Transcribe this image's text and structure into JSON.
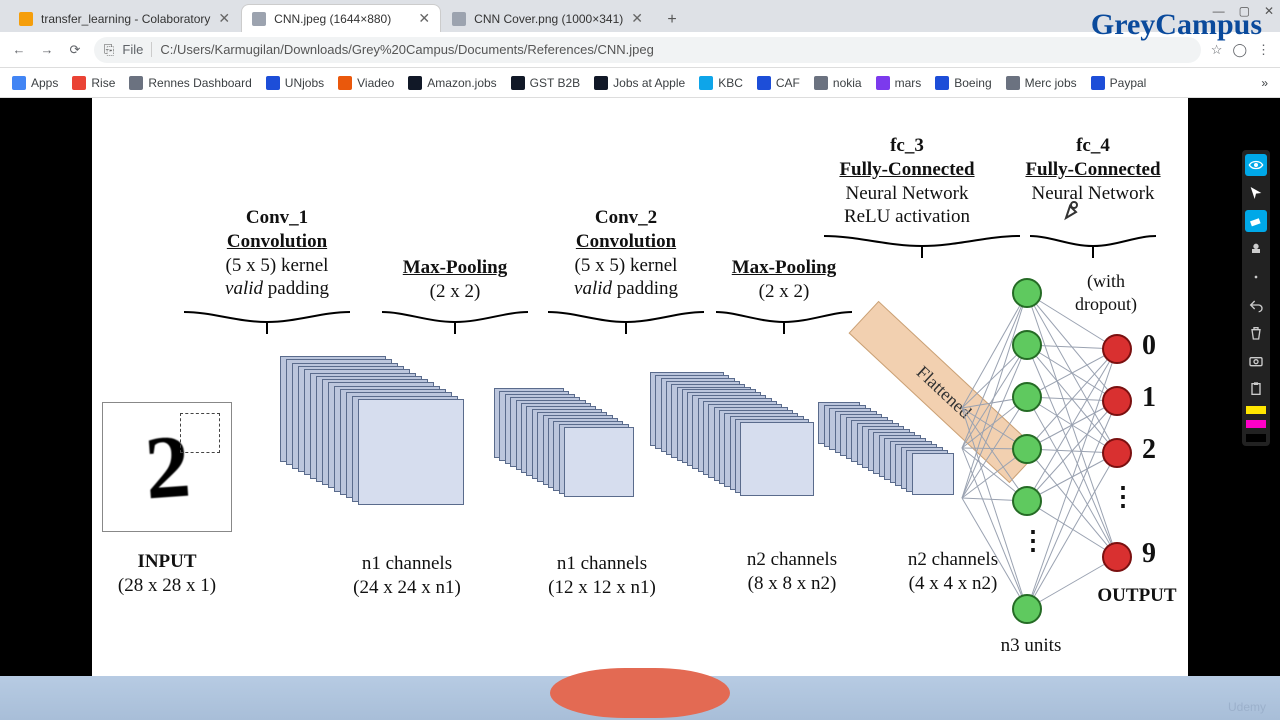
{
  "window": {
    "minimize": "—",
    "maximize": "▢",
    "close": "✕"
  },
  "tabs": [
    {
      "title": "transfer_learning - Colaboratory",
      "active": false,
      "favicon": "#f59e0b"
    },
    {
      "title": "CNN.jpeg (1644×880)",
      "active": true,
      "favicon": "#9ca3af"
    },
    {
      "title": "CNN Cover.png (1000×341)",
      "active": false,
      "favicon": "#9ca3af"
    }
  ],
  "newTab": "+",
  "nav": {
    "back": "←",
    "forward": "→",
    "reload": "⟳"
  },
  "omnibox": {
    "scheme": "File",
    "path": "C:/Users/Karmugilan/Downloads/Grey%20Campus/Documents/References/CNN.jpeg",
    "page_icon": "⎘"
  },
  "addr_right": {
    "star": "☆",
    "user": "◯",
    "menu": "⋮"
  },
  "bookmarks": [
    {
      "label": "Apps",
      "color": "#4285f4"
    },
    {
      "label": "Rise",
      "color": "#ea4335"
    },
    {
      "label": "Rennes Dashboard",
      "color": "#6b7280"
    },
    {
      "label": "UNjobs",
      "color": "#1d4ed8"
    },
    {
      "label": "Viadeo",
      "color": "#ea580c"
    },
    {
      "label": "Amazon.jobs",
      "color": "#111827"
    },
    {
      "label": "GST B2B",
      "color": "#111827"
    },
    {
      "label": "Jobs at Apple",
      "color": "#111827"
    },
    {
      "label": "KBC",
      "color": "#0ea5e9"
    },
    {
      "label": "CAF",
      "color": "#1d4ed8"
    },
    {
      "label": "nokia",
      "color": "#6b7280"
    },
    {
      "label": "mars",
      "color": "#7c3aed"
    },
    {
      "label": "Boeing",
      "color": "#1d4ed8"
    },
    {
      "label": "Merc jobs",
      "color": "#6b7280"
    },
    {
      "label": "Paypal",
      "color": "#1d4ed8"
    }
  ],
  "bookmarks_more": "»",
  "brand": "GreyCampus",
  "udemy": "Udemy",
  "diagram": {
    "input": {
      "title": "INPUT",
      "shape": "(28 x 28 x 1)",
      "glyph": "2"
    },
    "conv1": {
      "name": "Conv_1",
      "type": "Convolution",
      "kernel": "(5 x 5) kernel",
      "padding_prefix": "valid",
      "padding_suffix": " padding",
      "channels": "n1 channels",
      "outshape": "(24 x 24 x n1)"
    },
    "pool1": {
      "name": "Max-Pooling",
      "size": "(2 x 2)",
      "channels": "n1 channels",
      "outshape": "(12 x 12 x n1)"
    },
    "conv2": {
      "name": "Conv_2",
      "type": "Convolution",
      "kernel": "(5 x 5) kernel",
      "padding_prefix": "valid",
      "padding_suffix": " padding",
      "channels": "n2 channels",
      "outshape": "(8 x 8 x n2)"
    },
    "pool2": {
      "name": "Max-Pooling",
      "size": "(2 x 2)",
      "channels": "n2 channels",
      "outshape": "(4 x 4 x n2)"
    },
    "flat": "Flattened",
    "fc3": {
      "name": "fc_3",
      "type": "Fully-Connected",
      "sub1": "Neural Network",
      "sub2": "ReLU activation",
      "units": "n3 units"
    },
    "fc4": {
      "name": "fc_4",
      "type": "Fully-Connected",
      "sub1": "Neural Network",
      "dropout": "(with\ndropout)",
      "out0": "0",
      "out1": "1",
      "out2": "2",
      "out9": "9",
      "output": "OUTPUT"
    },
    "dots": "⋮"
  }
}
